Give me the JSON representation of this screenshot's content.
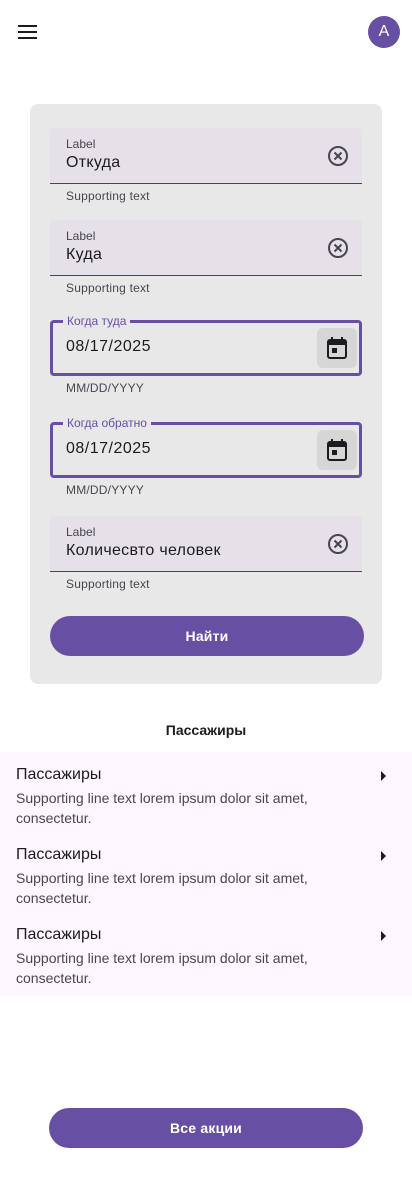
{
  "header": {
    "menu_icon": "menu-icon",
    "avatar_letter": "A",
    "accent_color": "#6750a4"
  },
  "form": {
    "from": {
      "label": "Label",
      "value": "Откуда",
      "supporting": "Supporting text",
      "icon": "clear-icon"
    },
    "to": {
      "label": "Label",
      "value": "Куда",
      "supporting": "Supporting text",
      "icon": "clear-icon"
    },
    "depart": {
      "label": "Когда туда",
      "value": "08/17/2025",
      "supporting": "MM/DD/YYYY",
      "icon": "calendar-icon"
    },
    "return": {
      "label": "Когда обратно",
      "value": "08/17/2025",
      "supporting": "MM/DD/YYYY",
      "icon": "calendar-icon"
    },
    "people": {
      "label": "Label",
      "value": "Количесвто человек",
      "supporting": "Supporting text",
      "icon": "clear-icon"
    },
    "search_button": "Найти"
  },
  "passengers": {
    "title": "Пассажиры",
    "items": [
      {
        "title": "Пассажиры",
        "subtitle": "Supporting line text lorem ipsum dolor sit amet, consectetur."
      },
      {
        "title": "Пассажиры",
        "subtitle": "Supporting line text lorem ipsum dolor sit amet, consectetur."
      },
      {
        "title": "Пассажиры",
        "subtitle": "Supporting line text lorem ipsum dolor sit amet, consectetur."
      }
    ]
  },
  "footer": {
    "all_promos_button": "Все акции"
  }
}
